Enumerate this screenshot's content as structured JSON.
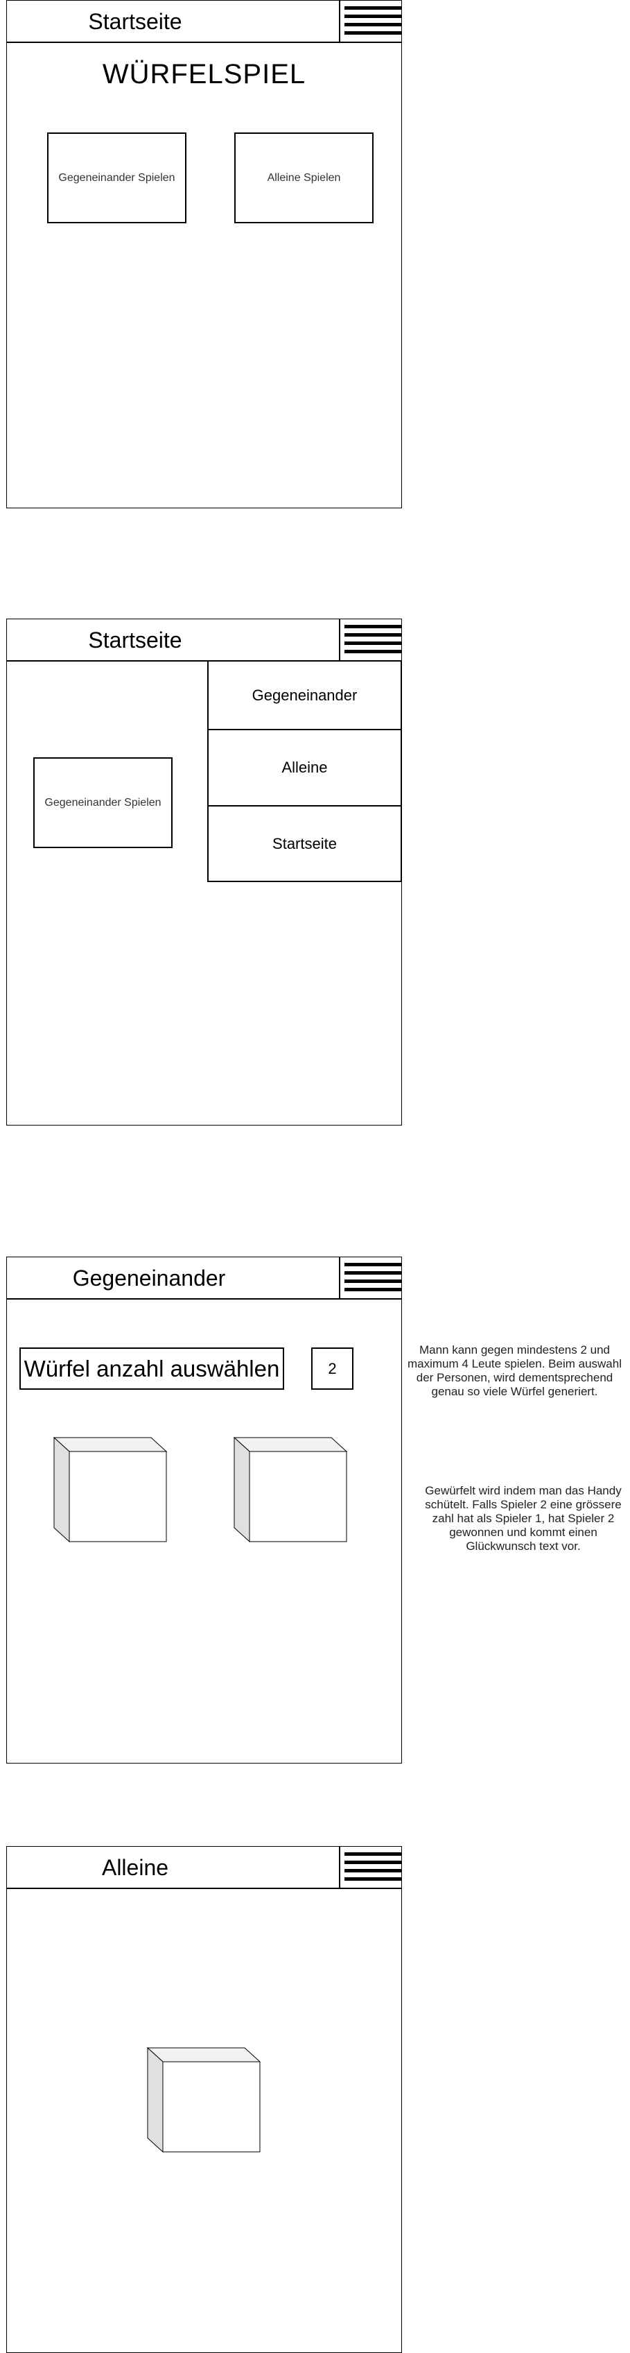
{
  "screen1": {
    "header_title": "Startseite",
    "heading": "WÜRFELSPIEL",
    "btn_versus": "Gegeneinander Spielen",
    "btn_alone": "Alleine Spielen"
  },
  "screen2": {
    "header_title": "Startseite",
    "btn_versus": "Gegeneinander Spielen",
    "menu": [
      "Gegeneinander",
      "Alleine",
      "Startseite"
    ]
  },
  "screen3": {
    "header_title": "Gegeneinander",
    "select_label": "Würfel anzahl auswählen",
    "count_value": "2",
    "note_players": "Mann kann gegen mindestens 2 und maximum 4 Leute spielen. Beim auswahl der Personen, wird dementsprechend genau so viele Würfel generiert.",
    "note_roll": "Gewürfelt wird indem man das Handy schütelt. Falls Spieler 2 eine grössere zahl hat als Spieler 1, hat Spieler 2 gewonnen und kommt einen Glückwunsch text vor."
  },
  "screen4": {
    "header_title": "Alleine"
  }
}
